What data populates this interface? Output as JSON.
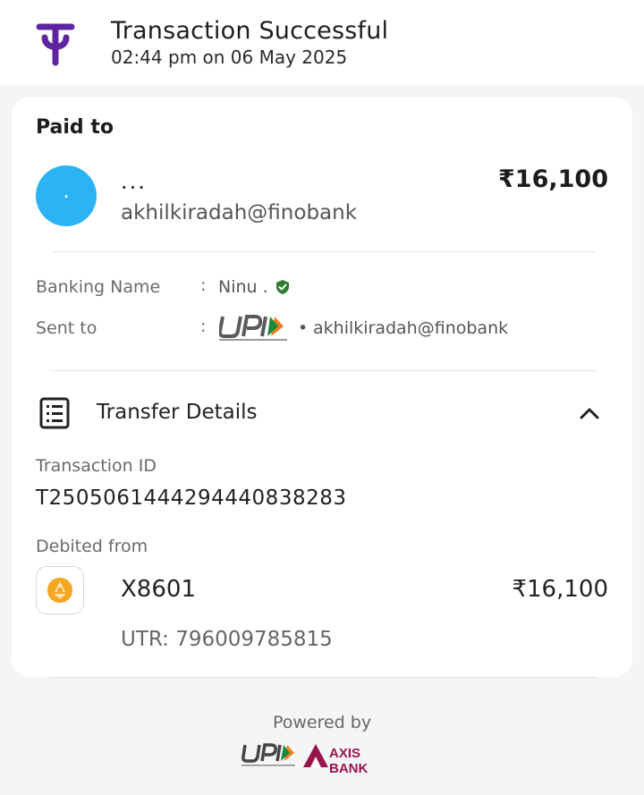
{
  "header": {
    "title": "Transaction Successful",
    "datetime": "02:44 pm on 06 May 2025",
    "logo_icon": "phonepe-logo-icon",
    "brand_color": "#5f259f"
  },
  "paid_to": {
    "heading": "Paid to",
    "avatar_text": ".",
    "name": "...",
    "upi_id": "akhilkiradah@finobank",
    "amount": "₹16,100"
  },
  "details": {
    "banking_name_label": "Banking Name",
    "banking_name_value": "Ninu .",
    "sent_to_label": "Sent to",
    "sent_to_value": "akhilkiradah@finobank",
    "colon": ":",
    "separator": "•",
    "verified_color": "#2e7d32"
  },
  "transfer": {
    "title": "Transfer Details",
    "txn_label": "Transaction ID",
    "txn_id": "T2505061444294440838283",
    "debited_label": "Debited from",
    "account": "X8601",
    "amount": "₹16,100",
    "utr": "UTR: 796009785815"
  },
  "footer": {
    "powered_by": "Powered by",
    "bank_name": "AXIS BANK",
    "axis_color": "#97144d"
  }
}
